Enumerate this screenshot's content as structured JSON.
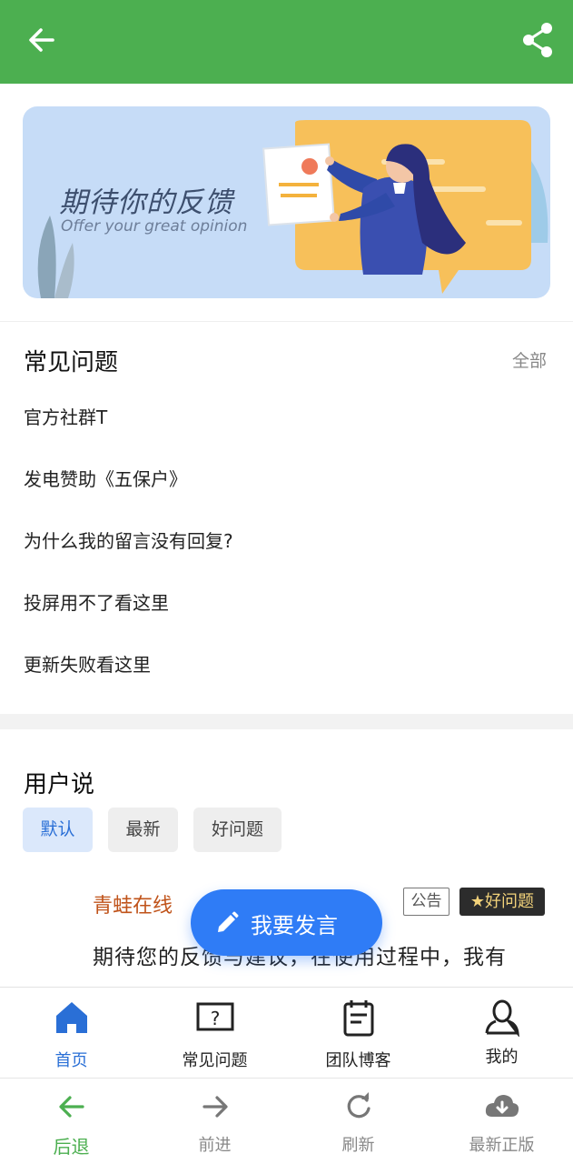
{
  "header": {
    "back_icon": "arrow-left-icon",
    "share_icon": "share-icon",
    "background_color": "#4caf50"
  },
  "banner": {
    "title": "期待你的反馈",
    "subtitle": "Offer your great opinion"
  },
  "faq": {
    "title": "常见问题",
    "all_label": "全部",
    "items": [
      "官方社群T",
      "发电赞助《五保户》",
      "为什么我的留言没有回复?",
      "投屏用不了看这里",
      "更新失败看这里"
    ]
  },
  "user_says": {
    "title": "用户说",
    "filters": [
      "默认",
      "最新",
      "好问题"
    ],
    "active_filter": "默认",
    "post": {
      "author": "青蛙在线",
      "tag_notice": "公告",
      "tag_good": "★好问题",
      "body": "期待您的反馈与建议，在使用过程中，我有"
    }
  },
  "fab": {
    "label": "我要发言",
    "icon": "pencil-icon",
    "color": "#2f7cf6"
  },
  "tabbar": {
    "items": [
      {
        "label": "首页",
        "icon": "home-icon"
      },
      {
        "label": "常见问题",
        "icon": "question-box-icon"
      },
      {
        "label": "团队博客",
        "icon": "notepad-icon"
      },
      {
        "label": "我的",
        "icon": "user-icon"
      }
    ],
    "active": "首页",
    "accent": "#2a6fd6"
  },
  "browser_nav": {
    "items": [
      {
        "label": "后退",
        "icon": "arrow-left-icon"
      },
      {
        "label": "前进",
        "icon": "arrow-right-icon"
      },
      {
        "label": "刷新",
        "icon": "refresh-icon"
      },
      {
        "label": "最新正版",
        "icon": "cloud-download-icon"
      }
    ],
    "active": "后退",
    "accent": "#4caf50"
  }
}
